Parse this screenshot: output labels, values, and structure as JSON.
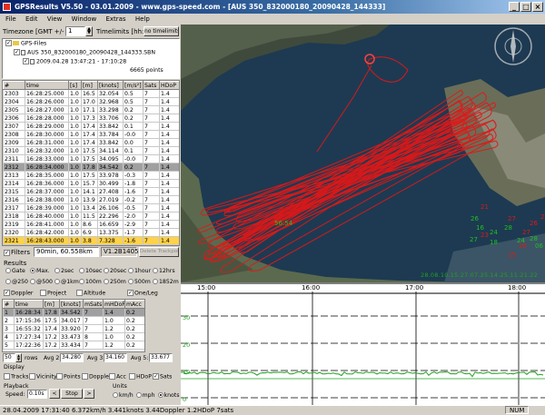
{
  "window": {
    "title": "GPSResults V5.50 - 03.01.2009 - www.gps-speed.com - [AUS 350_832000180_20090428_144333]"
  },
  "menu": [
    "File",
    "Edit",
    "View",
    "Window",
    "Extras",
    "Help"
  ],
  "timezone": {
    "label": "Timezone [GMT +/- h]",
    "value": "1",
    "timelimits_label": "Timelimits [hh:mm]",
    "no_timelimits": "no timelimits"
  },
  "tree": {
    "root": "GPS-Files",
    "file": "AUS 350_832000180_20090428_144333.SBN",
    "session": "2009.04.28 13:47:21 - 17:10:28",
    "points": "6665 points"
  },
  "points_table": {
    "headers": [
      "#",
      "time",
      "[s]",
      "[m]",
      "[knots]",
      "[m/s²]",
      "Sats",
      "HDoP"
    ],
    "rows": [
      [
        "2303",
        "16:28:25.000",
        "1.0",
        "16.5",
        "32.054",
        "0.5",
        "7",
        "1.4"
      ],
      [
        "2304",
        "16:28:26.000",
        "1.0",
        "17.0",
        "32.968",
        "0.5",
        "7",
        "1.4"
      ],
      [
        "2305",
        "16:28:27.000",
        "1.0",
        "17.1",
        "33.298",
        "0.2",
        "7",
        "1.4"
      ],
      [
        "2306",
        "16:28:28.000",
        "1.0",
        "17.3",
        "33.706",
        "0.2",
        "7",
        "1.4"
      ],
      [
        "2307",
        "16:28:29.000",
        "1.0",
        "17.4",
        "33.842",
        "0.1",
        "7",
        "1.4"
      ],
      [
        "2308",
        "16:28:30.000",
        "1.0",
        "17.4",
        "33.784",
        "-0.0",
        "7",
        "1.4"
      ],
      [
        "2309",
        "16:28:31.000",
        "1.0",
        "17.4",
        "33.842",
        "0.0",
        "7",
        "1.4"
      ],
      [
        "2310",
        "16:28:32.000",
        "1.0",
        "17.5",
        "34.114",
        "0.1",
        "7",
        "1.4"
      ],
      [
        "2311",
        "16:28:33.000",
        "1.0",
        "17.5",
        "34.095",
        "-0.0",
        "7",
        "1.4"
      ],
      [
        "2312",
        "16:28:34.000",
        "1.0",
        "17.8",
        "34.542",
        "0.2",
        "7",
        "1.4"
      ],
      [
        "2313",
        "16:28:35.000",
        "1.0",
        "17.5",
        "33.978",
        "-0.3",
        "7",
        "1.4"
      ],
      [
        "2314",
        "16:28:36.000",
        "1.0",
        "15.7",
        "30.499",
        "-1.8",
        "7",
        "1.4"
      ],
      [
        "2315",
        "16:28:37.000",
        "1.0",
        "14.1",
        "27.408",
        "-1.6",
        "7",
        "1.4"
      ],
      [
        "2316",
        "16:28:38.000",
        "1.0",
        "13.9",
        "27.019",
        "-0.2",
        "7",
        "1.4"
      ],
      [
        "2317",
        "16:28:39.000",
        "1.0",
        "13.4",
        "26.106",
        "-0.5",
        "7",
        "1.4"
      ],
      [
        "2318",
        "16:28:40.000",
        "1.0",
        "11.5",
        "22.296",
        "-2.0",
        "7",
        "1.4"
      ],
      [
        "2319",
        "16:28:41.000",
        "1.0",
        "8.6",
        "16.659",
        "-2.9",
        "7",
        "1.4"
      ],
      [
        "2320",
        "16:28:42.000",
        "1.0",
        "6.9",
        "13.375",
        "-1.7",
        "7",
        "1.4"
      ],
      [
        "2321",
        "16:28:43.000",
        "1.0",
        "3.8",
        "7.328",
        "-1.6",
        "7",
        "1.4"
      ]
    ],
    "selected_index": 9,
    "highlight_index": 18
  },
  "filters": {
    "label": "Filters",
    "value": "90min, 60.558km",
    "version": "V1.2B1405x",
    "delete_button": "Delete Trackpoint(s)"
  },
  "results": {
    "label": "Results",
    "row1": [
      "Gate",
      "Max.",
      "2sec",
      "10sec",
      "20sec",
      "1hour",
      "12hrs"
    ],
    "row2": [
      "@250",
      "@500",
      "@1km",
      "100m",
      "250m",
      "500m",
      "1852m"
    ],
    "row3": [
      "Doppler",
      "Project",
      "Altitude",
      "One/Leg"
    ],
    "headers": [
      "#",
      "time",
      "[m]",
      "[knots]",
      "mSats",
      "mHDoP",
      "mAcc"
    ],
    "rows": [
      [
        "1",
        "16:28:34",
        "17.8",
        "34.542",
        "7",
        "1.4",
        "0.2"
      ],
      [
        "2",
        "17:15:36",
        "17.5",
        "34.017",
        "7",
        "1.0",
        "0.2"
      ],
      [
        "3",
        "16:55:32",
        "17.4",
        "33.920",
        "7",
        "1.2",
        "0.2"
      ],
      [
        "4",
        "17:27:34",
        "17.2",
        "33.473",
        "8",
        "1.0",
        "0.2"
      ],
      [
        "5",
        "17:22:36",
        "17.2",
        "33.434",
        "7",
        "1.2",
        "0.2"
      ]
    ]
  },
  "avg_row": {
    "count": "50",
    "rows_label": "rows",
    "avg2_label": "Avg 2:",
    "avg2": "34.280",
    "avg3_label": "Avg 3:",
    "avg3": "34.160",
    "avg5_label": "Avg 5:",
    "avg5": "33.677"
  },
  "display": {
    "label": "Display",
    "items": [
      "Tracks",
      "Vicinity",
      "Points",
      "Doppler",
      "Acc",
      "HDoP",
      "Sats"
    ]
  },
  "playback": {
    "label": "Playback",
    "speed_label": "Speed:",
    "speed_value": "0.10s",
    "stop": "Stop",
    "units_label": "Units",
    "units": [
      "km/h",
      "mph",
      "knots"
    ]
  },
  "map": {
    "labels_red": [
      "21",
      "27",
      "26",
      "27",
      "27",
      "26",
      "25",
      "23"
    ],
    "labels_green": [
      "26",
      "16",
      "24",
      "27",
      "18",
      "28",
      "24",
      "28",
      "06"
    ],
    "speed_label": "56:54",
    "bottom_dates": "28.08.10.15.27.07.25.14.25.11.21.22"
  },
  "graph": {
    "time_ticks": [
      "15:00",
      "16:00",
      "17:00",
      "18:00"
    ],
    "y_labels": [
      "30",
      "20",
      "10",
      "0"
    ]
  },
  "status": {
    "text": "28.04.2009 17:31:40   6.372km/h   3.441knots   3.44Doppler   1.2HDoP   7sats",
    "num": "NUM"
  },
  "colors": {
    "track": "#e01818",
    "highlight_row": "#ffd24a",
    "title_start": "#0a246a",
    "speed_line": "#20a020",
    "water": "#1d3a52"
  }
}
